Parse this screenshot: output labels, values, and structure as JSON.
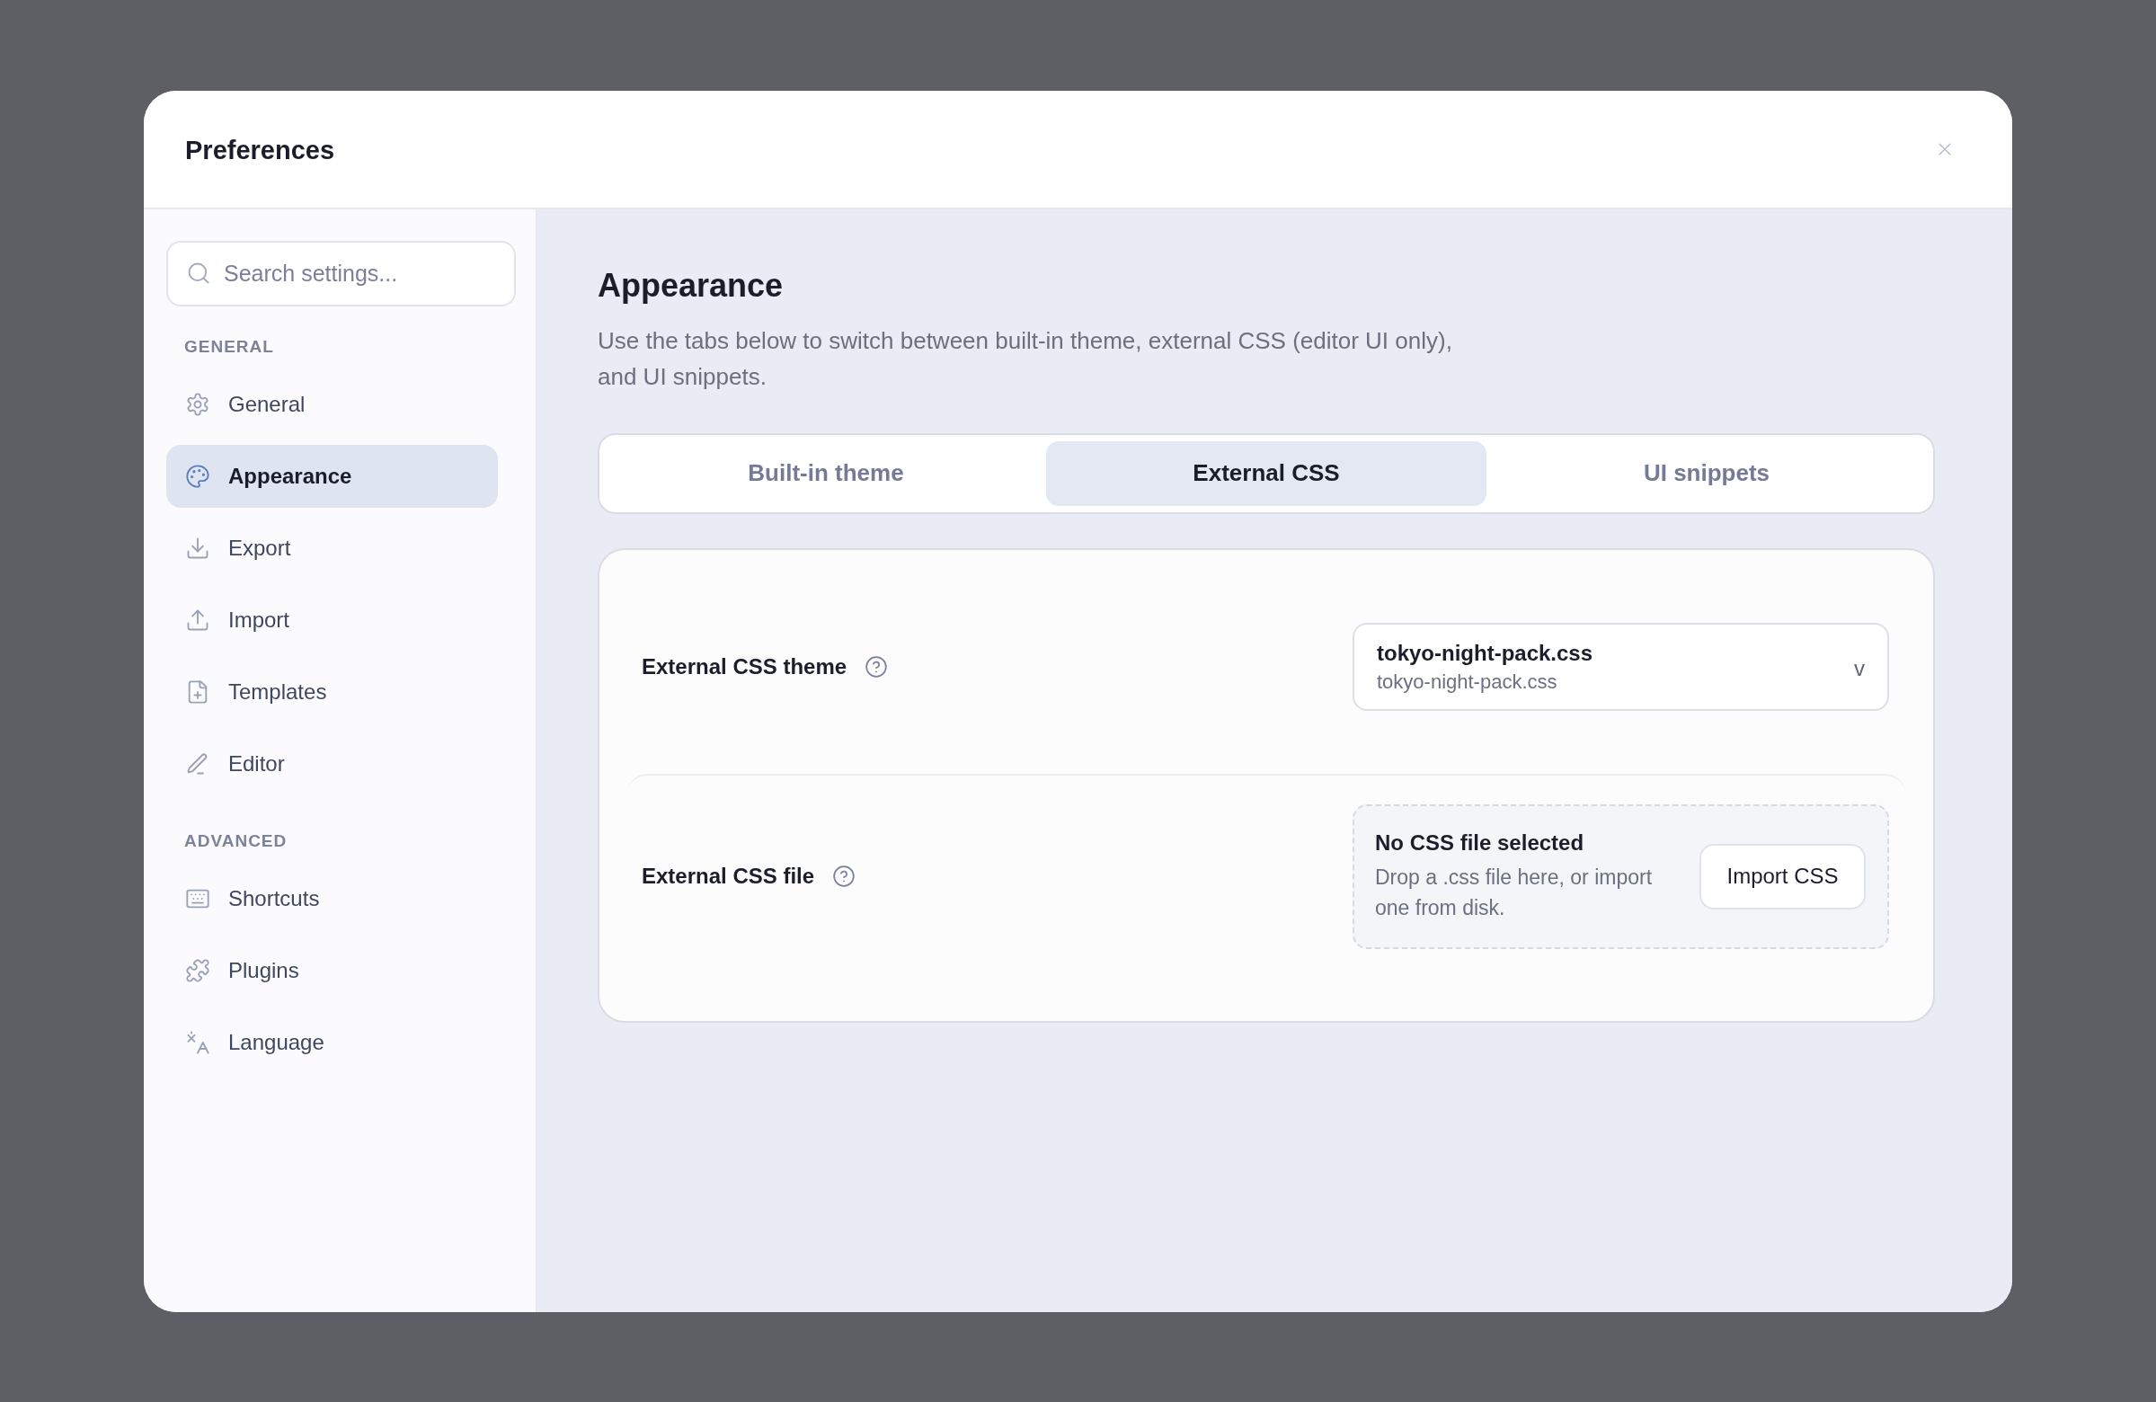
{
  "window": {
    "title": "Preferences"
  },
  "sidebar": {
    "search": {
      "placeholder": "Search settings..."
    },
    "groups": [
      {
        "heading": "GENERAL",
        "items": [
          {
            "label": "General",
            "selected": false
          },
          {
            "label": "Appearance",
            "selected": true
          },
          {
            "label": "Export",
            "selected": false
          },
          {
            "label": "Import",
            "selected": false
          },
          {
            "label": "Templates",
            "selected": false
          },
          {
            "label": "Editor",
            "selected": false
          }
        ]
      },
      {
        "heading": "ADVANCED",
        "items": [
          {
            "label": "Shortcuts",
            "selected": false
          },
          {
            "label": "Plugins",
            "selected": false
          },
          {
            "label": "Language",
            "selected": false
          }
        ]
      }
    ]
  },
  "main": {
    "heading": "Appearance",
    "description": "Use the tabs below to switch between built-in theme, external CSS (editor UI only), and UI snippets.",
    "tabs": [
      {
        "label": "Built-in theme",
        "selected": false
      },
      {
        "label": "External CSS",
        "selected": true
      },
      {
        "label": "UI snippets",
        "selected": false
      }
    ],
    "settings": [
      {
        "kind": "select",
        "label": "External CSS theme",
        "value": "tokyo-night-pack.css",
        "detail": "tokyo-night-pack.css",
        "caret": "v"
      },
      {
        "kind": "file",
        "label": "External CSS file",
        "title": "No CSS file selected",
        "hint": "Drop a .css file here, or import one from disk.",
        "button": "Import CSS"
      }
    ]
  }
}
